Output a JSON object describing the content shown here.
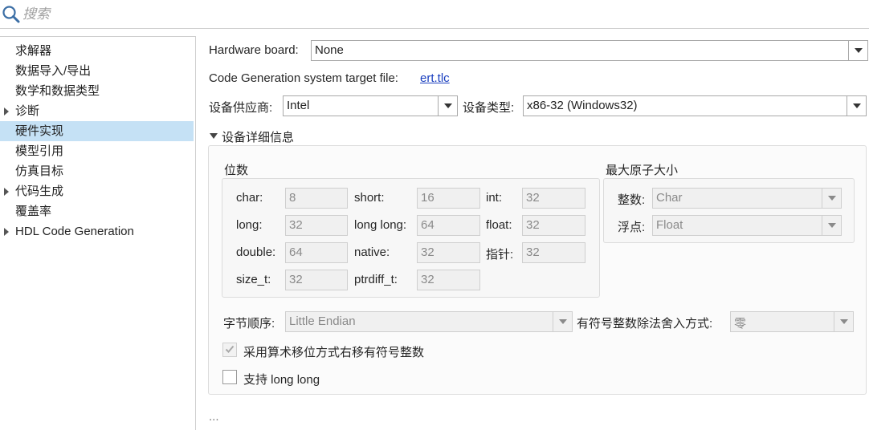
{
  "search": {
    "placeholder": "搜索"
  },
  "sidebar": {
    "items": [
      {
        "label": "求解器",
        "expandable": false,
        "selected": false
      },
      {
        "label": "数据导入/导出",
        "expandable": false,
        "selected": false
      },
      {
        "label": "数学和数据类型",
        "expandable": false,
        "selected": false
      },
      {
        "label": "诊断",
        "expandable": true,
        "selected": false
      },
      {
        "label": "硬件实现",
        "expandable": false,
        "selected": true
      },
      {
        "label": "模型引用",
        "expandable": false,
        "selected": false
      },
      {
        "label": "仿真目标",
        "expandable": false,
        "selected": false
      },
      {
        "label": "代码生成",
        "expandable": true,
        "selected": false
      },
      {
        "label": "覆盖率",
        "expandable": false,
        "selected": false
      },
      {
        "label": "HDL Code Generation",
        "expandable": true,
        "selected": false
      }
    ]
  },
  "main": {
    "hardware_board": {
      "label": "Hardware board:",
      "value": "None"
    },
    "target_file": {
      "label": "Code Generation system target file:",
      "link": "ert.tlc"
    },
    "device_vendor": {
      "label": "设备供应商:",
      "value": "Intel"
    },
    "device_type": {
      "label": "设备类型:",
      "value": "x86-32 (Windows32)"
    },
    "device_details": {
      "label": "设备详细信息",
      "bits_group": {
        "title": "位数",
        "fields": {
          "char": {
            "label": "char:",
            "value": "8"
          },
          "short": {
            "label": "short:",
            "value": "16"
          },
          "int": {
            "label": "int:",
            "value": "32"
          },
          "long": {
            "label": "long:",
            "value": "32"
          },
          "long_long": {
            "label": "long long:",
            "value": "64"
          },
          "float": {
            "label": "float:",
            "value": "32"
          },
          "double": {
            "label": "double:",
            "value": "64"
          },
          "native": {
            "label": "native:",
            "value": "32"
          },
          "pointer": {
            "label": "指针:",
            "value": "32"
          },
          "size_t": {
            "label": "size_t:",
            "value": "32"
          },
          "ptrdiff_t": {
            "label": "ptrdiff_t:",
            "value": "32"
          }
        }
      },
      "atomic_group": {
        "title": "最大原子大小",
        "integer": {
          "label": "整数:",
          "value": "Char"
        },
        "floating": {
          "label": "浮点:",
          "value": "Float"
        }
      },
      "byte_order": {
        "label": "字节顺序:",
        "value": "Little Endian"
      },
      "signed_div": {
        "label": "有符号整数除法舍入方式:",
        "value": "零"
      },
      "arith_shift": {
        "label": "采用算术移位方式右移有符号整数",
        "checked": true,
        "disabled": true
      },
      "support_long_long": {
        "label": "支持 long long",
        "checked": false,
        "disabled": false
      }
    },
    "ellipsis": "..."
  }
}
